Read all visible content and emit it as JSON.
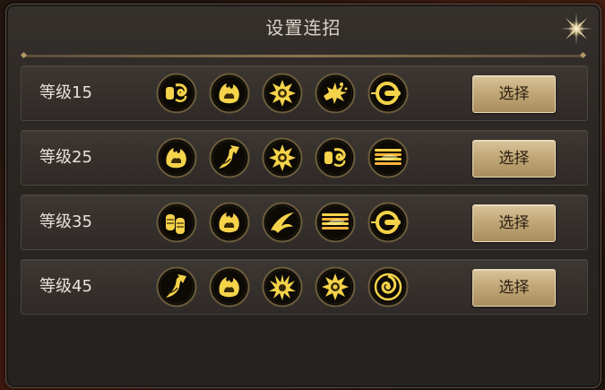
{
  "dialog": {
    "title": "设置连招"
  },
  "rows": [
    {
      "label": "等级15",
      "button": "选择",
      "skills": [
        "fist-swirl-icon",
        "fire-claw-icon",
        "sunburst-icon",
        "explosion-icon",
        "ring-dash-icon"
      ]
    },
    {
      "label": "等级25",
      "button": "选择",
      "skills": [
        "fire-claw-icon",
        "rising-arrow-icon",
        "sunburst-icon",
        "fist-swirl-icon",
        "flame-stripe-icon"
      ]
    },
    {
      "label": "等级35",
      "button": "选择",
      "skills": [
        "double-fist-icon",
        "fire-claw-icon",
        "slash-icon",
        "flame-stripe-icon",
        "ring-dash-icon"
      ]
    },
    {
      "label": "等级45",
      "button": "选择",
      "skills": [
        "rising-arrow-icon",
        "fire-claw-icon",
        "burst-shard-icon",
        "sunburst-icon",
        "vortex-icon"
      ]
    }
  ],
  "colors": {
    "icon_glow": "#f5d34a",
    "button_face": "#c2a878",
    "panel": "#2a2623"
  }
}
